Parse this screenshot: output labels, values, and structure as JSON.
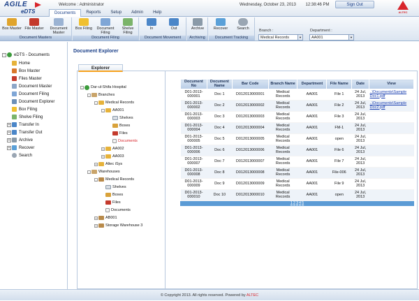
{
  "app": {
    "logo_main": "AGILE",
    "logo_sub": "eDTS",
    "welcome": "Welcome : Administrator",
    "date": "Wednesday, October 23, 2013",
    "time": "12:38:46 PM",
    "signout": "Sign Out",
    "brand": "ALTEC"
  },
  "tabs": [
    "Documents",
    "Reports",
    "Setup",
    "Admin",
    "Help"
  ],
  "ribbon": {
    "groups": [
      {
        "label": "Document Masters",
        "buttons": [
          "Box Master",
          "File Master",
          "Document Master"
        ]
      },
      {
        "label": "Document Filing",
        "buttons": [
          "Box Filing",
          "Document Filing",
          "Shelve Filing"
        ]
      },
      {
        "label": "Document Movement",
        "buttons": [
          "In",
          "Out"
        ]
      },
      {
        "label": "Archiving",
        "buttons": [
          "Archive"
        ]
      },
      {
        "label": "Document Tracking",
        "buttons": [
          "Recover",
          "Search"
        ]
      }
    ],
    "branch_label": "Branch :",
    "branch_value": "Medical Records",
    "department_label": "Department :",
    "department_value": "AA001"
  },
  "sidebar": {
    "root": "eDTS - Documents",
    "items": [
      "Home",
      "Box Master",
      "Files Master",
      "Document Master",
      "Document Filing",
      "Document Explorer",
      "Box Filing",
      "Shelve Filing",
      "Transfer In",
      "Transfer Out",
      "Archive",
      "Recover",
      "Search"
    ]
  },
  "page": {
    "title": "Document Explorer",
    "explorer_tab": "Explorer"
  },
  "tree": [
    "Dar-ul-Shifa Hospital",
    "Branches",
    "Medical Records",
    "AA001",
    "Shelves",
    "Boxes",
    "Files",
    "Documents",
    "AA002",
    "AA003",
    "Altec iSys",
    "Warehouses",
    "Medical Records",
    "Shelves",
    "Boxes",
    "Files",
    "Documents",
    "AB001",
    "Storage Warehouse 3"
  ],
  "grid": {
    "columns": [
      "Document No",
      "Document Name",
      "Bar Code",
      "Branch Name",
      "Department",
      "File Name",
      "Date",
      "View"
    ],
    "rows": [
      [
        "D01-2013-000001",
        "Doc 1",
        "D012013000001",
        "Medical Records",
        "AA001",
        "File 1",
        "24 Jul, 2013",
        "..\\Documents\\Sample Doc1.pdf"
      ],
      [
        "D01-2013-000002",
        "Doc 2",
        "D012013000002",
        "Medical Records",
        "AA001",
        "File 2",
        "24 Jul, 2013",
        "..\\Documents\\Sample Doc2.pdf"
      ],
      [
        "D01-2013-000003",
        "Doc 3",
        "D012013000003",
        "Medical Records",
        "AA001",
        "File 3",
        "24 Jul, 2013",
        ""
      ],
      [
        "D01-2013-000004",
        "Doc 4",
        "D012013000004",
        "Medical Records",
        "AA001",
        "FM-1",
        "24 Jul, 2013",
        ""
      ],
      [
        "D01-2013-000005",
        "Doc 5",
        "D012013000005",
        "Medical Records",
        "AA001",
        "open",
        "24 Jul, 2013",
        ""
      ],
      [
        "D01-2013-000006",
        "Doc 6",
        "D012013000006",
        "Medical Records",
        "AA001",
        "File 6",
        "24 Jul, 2013",
        ""
      ],
      [
        "D01-2013-000007",
        "Doc 7",
        "D012013000007",
        "Medical Records",
        "AA001",
        "File 7",
        "24 Jul, 2013",
        ""
      ],
      [
        "D01-2013-000008",
        "Doc 8",
        "D012013000008",
        "Medical Records",
        "AA001",
        "File-006",
        "24 Jul, 2013",
        ""
      ],
      [
        "D01-2013-000009",
        "Doc 9",
        "D012013000009",
        "Medical Records",
        "AA001",
        "File 9",
        "24 Jul, 2013",
        ""
      ],
      [
        "D01-2013-000010",
        "Doc 10",
        "D012013000010",
        "Medical Records",
        "AA001",
        "open",
        "24 Jul, 2013",
        ""
      ]
    ],
    "pages": [
      "1",
      "2",
      "3",
      "4",
      "5"
    ]
  },
  "footer": {
    "text": "© Copyright 2013. All rights reserved. Powered by",
    "link": "ALTEC"
  }
}
